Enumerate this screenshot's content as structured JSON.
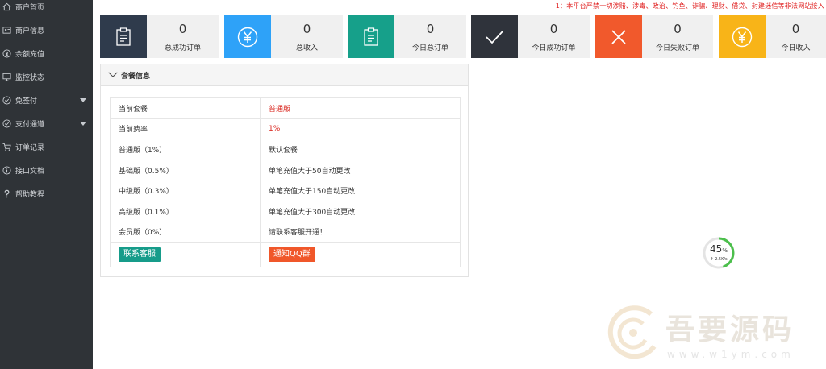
{
  "sidebar": {
    "items": [
      {
        "label": "商户首页",
        "icon": "home-icon"
      },
      {
        "label": "商户信息",
        "icon": "user-card-icon"
      },
      {
        "label": "余额充值",
        "icon": "yen-circle-icon"
      },
      {
        "label": "监控状态",
        "icon": "monitor-icon"
      },
      {
        "label": "免签付",
        "icon": "check-circle-icon",
        "has_caret": true
      },
      {
        "label": "支付通道",
        "icon": "check-circle-icon",
        "has_caret": true
      },
      {
        "label": "订单记录",
        "icon": "cart-icon"
      },
      {
        "label": "接口文档",
        "icon": "info-circle-icon"
      },
      {
        "label": "帮助教程",
        "icon": "question-icon"
      }
    ]
  },
  "notice": "1：本平台严禁一切涉赌、涉毒、政治、钓鱼、诈骗、理财、借贷、封建迷信等非法网站接入",
  "stats": [
    {
      "value": "0",
      "label": "总成功订单",
      "icon": "clipboard-icon",
      "color": "#2f3b4c"
    },
    {
      "value": "0",
      "label": "总收入",
      "icon": "yen-icon",
      "color": "#2ea2f8"
    },
    {
      "value": "0",
      "label": "今日总订单",
      "icon": "clipboard-icon",
      "color": "#16a08a"
    },
    {
      "value": "0",
      "label": "今日成功订单",
      "icon": "check-icon",
      "color": "#2f333b"
    },
    {
      "value": "0",
      "label": "今日失败订单",
      "icon": "close-icon",
      "color": "#f1592c"
    },
    {
      "value": "0",
      "label": "今日收入",
      "icon": "yen-icon",
      "color": "#f8b418"
    }
  ],
  "package": {
    "title": "套餐信息",
    "rows": [
      {
        "name": "当前套餐",
        "value": "普通版",
        "red": true
      },
      {
        "name": "当前费率",
        "value": "1%",
        "red": true
      },
      {
        "name": "普通版（1%）",
        "value": "默认套餐",
        "red": false
      },
      {
        "name": "基础版（0.5%）",
        "value": "单笔充值大于50自动更改",
        "red": false
      },
      {
        "name": "中级版（0.3%）",
        "value": "单笔充值大于150自动更改",
        "red": false
      },
      {
        "name": "高级版（0.1%）",
        "value": "单笔充值大于300自动更改",
        "red": false
      },
      {
        "name": "会员版（0%）",
        "value": "请联系客服开通！",
        "red": false
      }
    ],
    "contact_button": "联系客服",
    "qq_button": "通知QQ群"
  },
  "speed_widget": {
    "percent": "45",
    "percent_unit": "%",
    "rate": "↑ 2.5K/s",
    "progress": 0.45
  },
  "watermark": {
    "brand": "吾要源码",
    "url": "www.w1ym.com"
  }
}
